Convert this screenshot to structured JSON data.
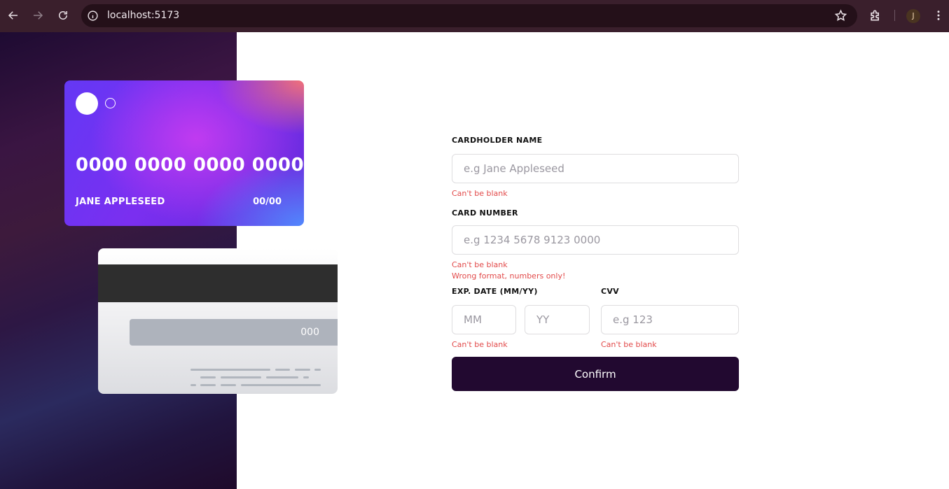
{
  "browser": {
    "url": "localhost:5173",
    "profile_initial": "J",
    "icons": [
      "back-arrow-icon",
      "forward-arrow-icon",
      "reload-icon",
      "info-icon",
      "star-icon",
      "extensions-icon",
      "kebab-menu-icon"
    ]
  },
  "card_front": {
    "number": "0000 0000 0000 0000",
    "name": "JANE APPLESEED",
    "expiry": "00/00"
  },
  "card_back": {
    "cvc": "000"
  },
  "form": {
    "cardholder_label": "CARDHOLDER NAME",
    "cardholder_placeholder": "e.g Jane Appleseed",
    "cardholder_error": "Can't be blank",
    "number_label": "CARD NUMBER",
    "number_placeholder": "e.g 1234 5678 9123 0000",
    "number_error_blank": "Can't be blank",
    "number_error_format": "Wrong format, numbers only!",
    "exp_label": "EXP. DATE (MM/YY)",
    "mm_placeholder": "MM",
    "yy_placeholder": "YY",
    "exp_error": "Can't be blank",
    "cvv_label": "CVV",
    "cvv_placeholder": "e.g 123",
    "cvv_error": "Can't be blank",
    "confirm_label": "Confirm"
  },
  "colors": {
    "error": "#e24a4a",
    "button": "#220930",
    "chrome": "#3a1f2c"
  }
}
